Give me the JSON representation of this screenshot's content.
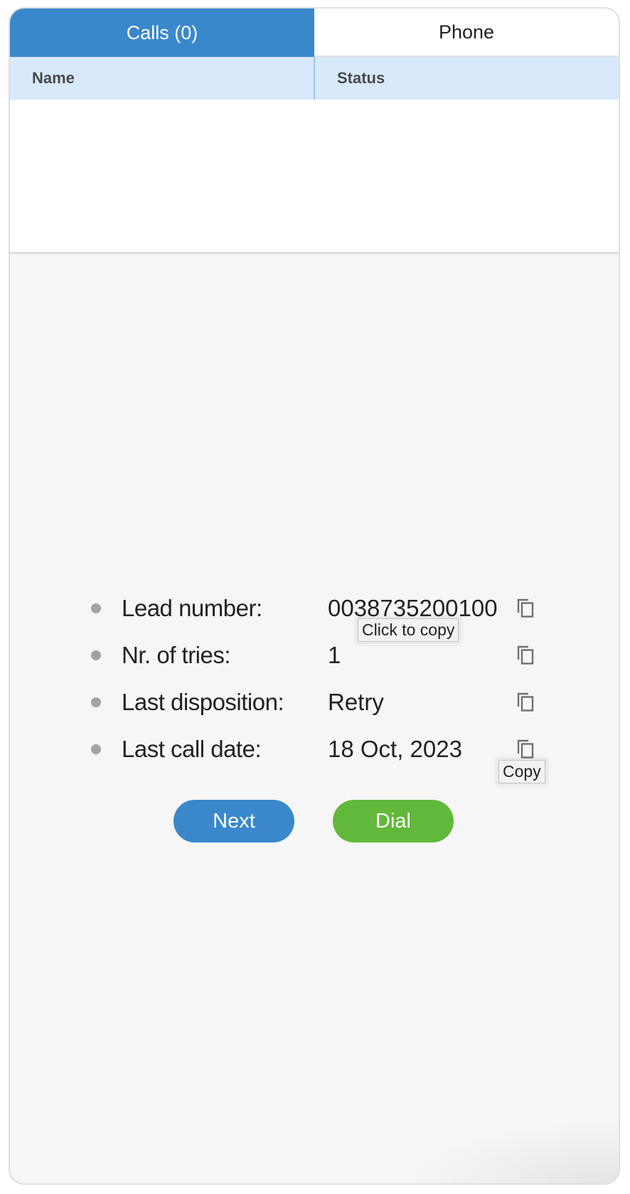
{
  "tabs": [
    {
      "label": "Calls (0)",
      "active": true
    },
    {
      "label": "Phone",
      "active": false
    }
  ],
  "table": {
    "columns": [
      "Name",
      "Status"
    ],
    "rows": []
  },
  "lead_info": [
    {
      "label": "Lead number:",
      "value": "0038735200100",
      "icon": "copy-icon"
    },
    {
      "label": "Nr. of tries:",
      "value": "1",
      "icon": "copy-icon"
    },
    {
      "label": "Last disposition:",
      "value": "Retry",
      "icon": "copy-icon"
    },
    {
      "label": "Last call date:",
      "value": "18 Oct, 2023",
      "icon": "copy-icon"
    }
  ],
  "tooltips": {
    "click_to_copy": "Click to copy",
    "copy": "Copy"
  },
  "buttons": {
    "next": "Next",
    "dial": "Dial"
  },
  "colors": {
    "primary": "#3a88cb",
    "success": "#62b83a",
    "table_header_bg": "#d8e9fc"
  }
}
